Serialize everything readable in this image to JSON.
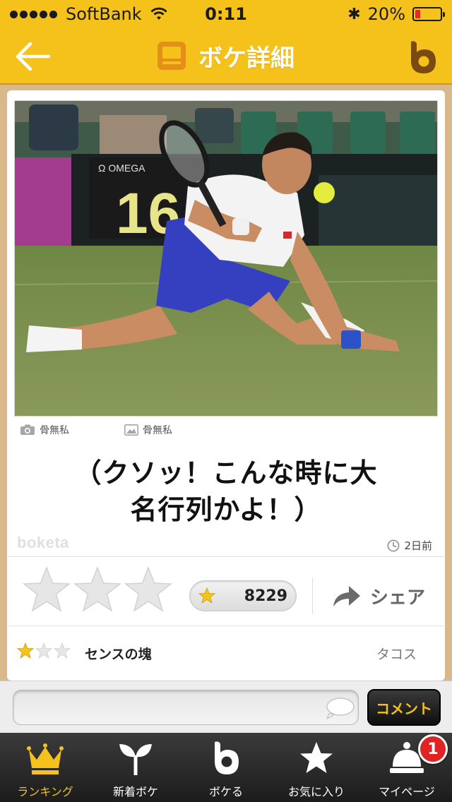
{
  "status_bar": {
    "carrier": "SoftBank",
    "time": "0:11",
    "battery_text": "20%",
    "battery_level": 0.2,
    "battery_color": "#e32b1f"
  },
  "nav": {
    "title": "ボケ詳細",
    "back_icon": "arrow-left-icon",
    "brand_icon": "boketa-b-logo-icon",
    "title_icon": "monitor-icon"
  },
  "post": {
    "photo_description_icon": "tennis-photo",
    "photo_credit": "骨無私",
    "boke_credit": "骨無私",
    "boke_lines": [
      "（クソッ！こんな時に大",
      "名行列かよ！）"
    ],
    "watermark": "boketa",
    "posted_ago": "2日前",
    "rating_stars_total": 3,
    "score": "8229",
    "share_label": "シェア"
  },
  "top_comment": {
    "stars_filled": 1,
    "stars_total": 3,
    "text": "センスの塊",
    "author": "タコス"
  },
  "comment_input": {
    "value": "",
    "placeholder": "",
    "submit_label": "コメント"
  },
  "tabs": [
    {
      "label": "ランキング",
      "icon": "crown-icon",
      "active": true
    },
    {
      "label": "新着ボケ",
      "icon": "sprout-icon",
      "active": false
    },
    {
      "label": "ボケる",
      "icon": "boketa-b-icon",
      "active": false
    },
    {
      "label": "お気に入り",
      "icon": "star-icon",
      "active": false
    },
    {
      "label": "マイページ",
      "icon": "profile-bell-icon",
      "active": false,
      "badge": "1"
    }
  ],
  "colors": {
    "accent": "#f5c21b",
    "title_icon": "#e38f1a",
    "star_filled": "#f4c418",
    "star_empty": "#e6e6e6",
    "tab_bar": "#262626",
    "badge": "#e02424"
  }
}
